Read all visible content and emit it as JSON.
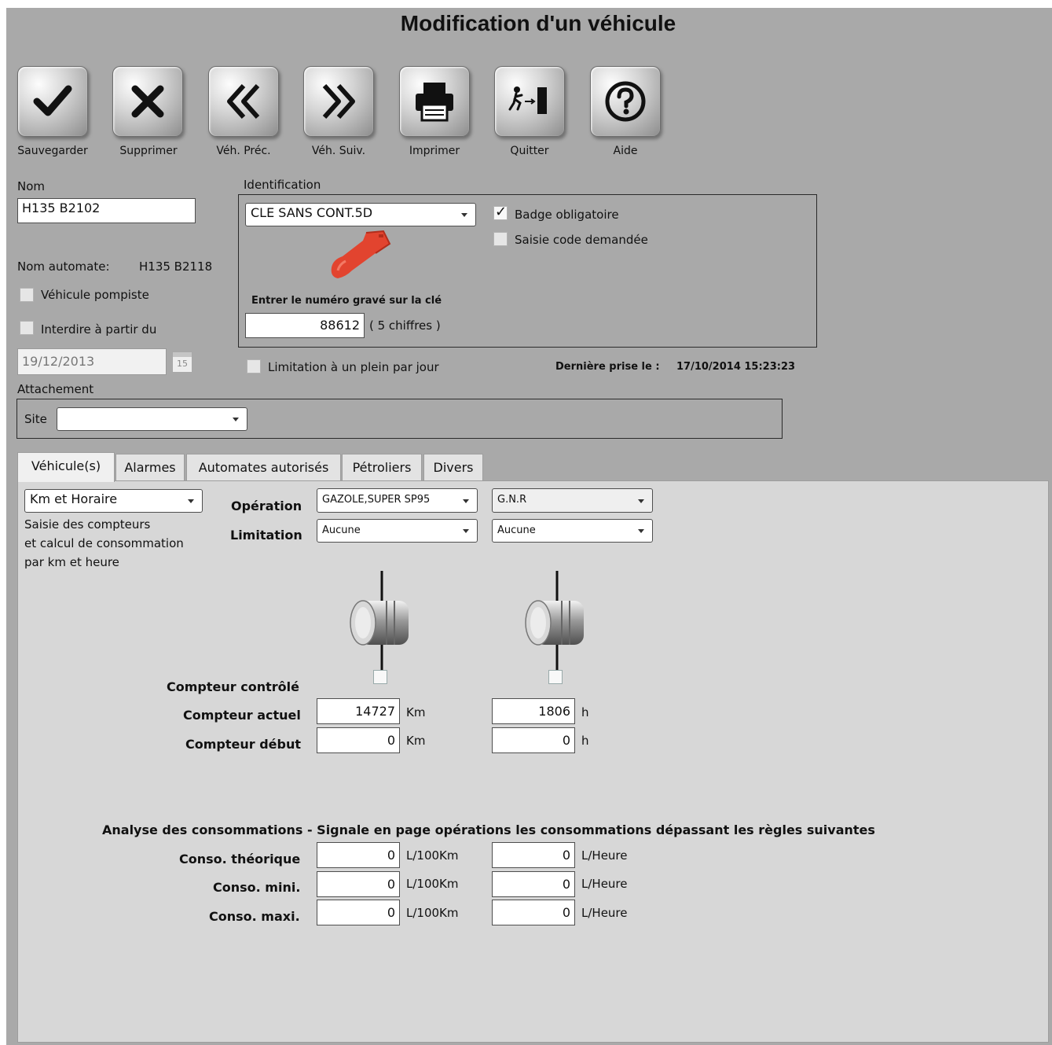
{
  "window": {
    "title": "Modification d'un véhicule"
  },
  "toolbar": {
    "save": "Sauvegarder",
    "delete": "Supprimer",
    "prev": "Véh. Préc.",
    "next": "Véh. Suiv.",
    "print": "Imprimer",
    "quit": "Quitter",
    "help": "Aide"
  },
  "vehicle": {
    "nom_label": "Nom",
    "nom_value": "H135 B2102",
    "nom_automate_label": "Nom automate:",
    "nom_automate_value": "H135 B2118",
    "pompiste_label": "Véhicule pompiste",
    "interdire_label": "Interdire à partir du",
    "interdire_date": "19/12/2013",
    "calendar_day": "15",
    "attachement_label": "Attachement",
    "site_label": "Site",
    "site_value": ""
  },
  "identification": {
    "label": "Identification",
    "type_value": "CLE SANS CONT.5D",
    "badge_label": "Badge obligatoire",
    "badge_checked": true,
    "saisie_label": "Saisie code demandée",
    "saisie_checked": false,
    "key_prompt": "Entrer le numéro gravé sur la clé",
    "key_number": "88612",
    "key_hint": "( 5 chiffres )",
    "key_color": "#e8402a"
  },
  "limitation_plein_label": "Limitation à un plein par jour",
  "derniere_prise": {
    "label": "Dernière prise le :",
    "value": "17/10/2014 15:23:23"
  },
  "tabs": [
    {
      "label": "Véhicule(s)",
      "active": true
    },
    {
      "label": "Alarmes"
    },
    {
      "label": "Automates autorisés"
    },
    {
      "label": "Pétroliers"
    },
    {
      "label": "Divers"
    }
  ],
  "panel": {
    "mode_value": "Km et Horaire",
    "mode_desc_1": "Saisie des compteurs",
    "mode_desc_2": "et calcul de consommation",
    "mode_desc_3": "par  km et heure",
    "operation_label": "Opération",
    "limitation_label": "Limitation",
    "op1": "GAZOLE,SUPER SP95",
    "op2": "G.N.R",
    "lim1": "Aucune",
    "lim2": "Aucune",
    "compteur_controle_label": "Compteur contrôlé",
    "compteur_actuel_label": "Compteur actuel",
    "compteur_debut_label": "Compteur début",
    "actuel1": "14727",
    "actuel2": "1806",
    "debut1": "0",
    "debut2": "0",
    "unit_km": "Km",
    "unit_h": "h",
    "analyse_title": "Analyse des consommations - Signale en page opérations les consommations dépassant les règles suivantes",
    "conso_theorique_label": "Conso. théorique",
    "conso_mini_label": "Conso. mini.",
    "conso_maxi_label": "Conso. maxi.",
    "conso_values": [
      "0",
      "0",
      "0",
      "0",
      "0",
      "0"
    ],
    "unit_l100": "L/100Km",
    "unit_lh": "L/Heure"
  }
}
